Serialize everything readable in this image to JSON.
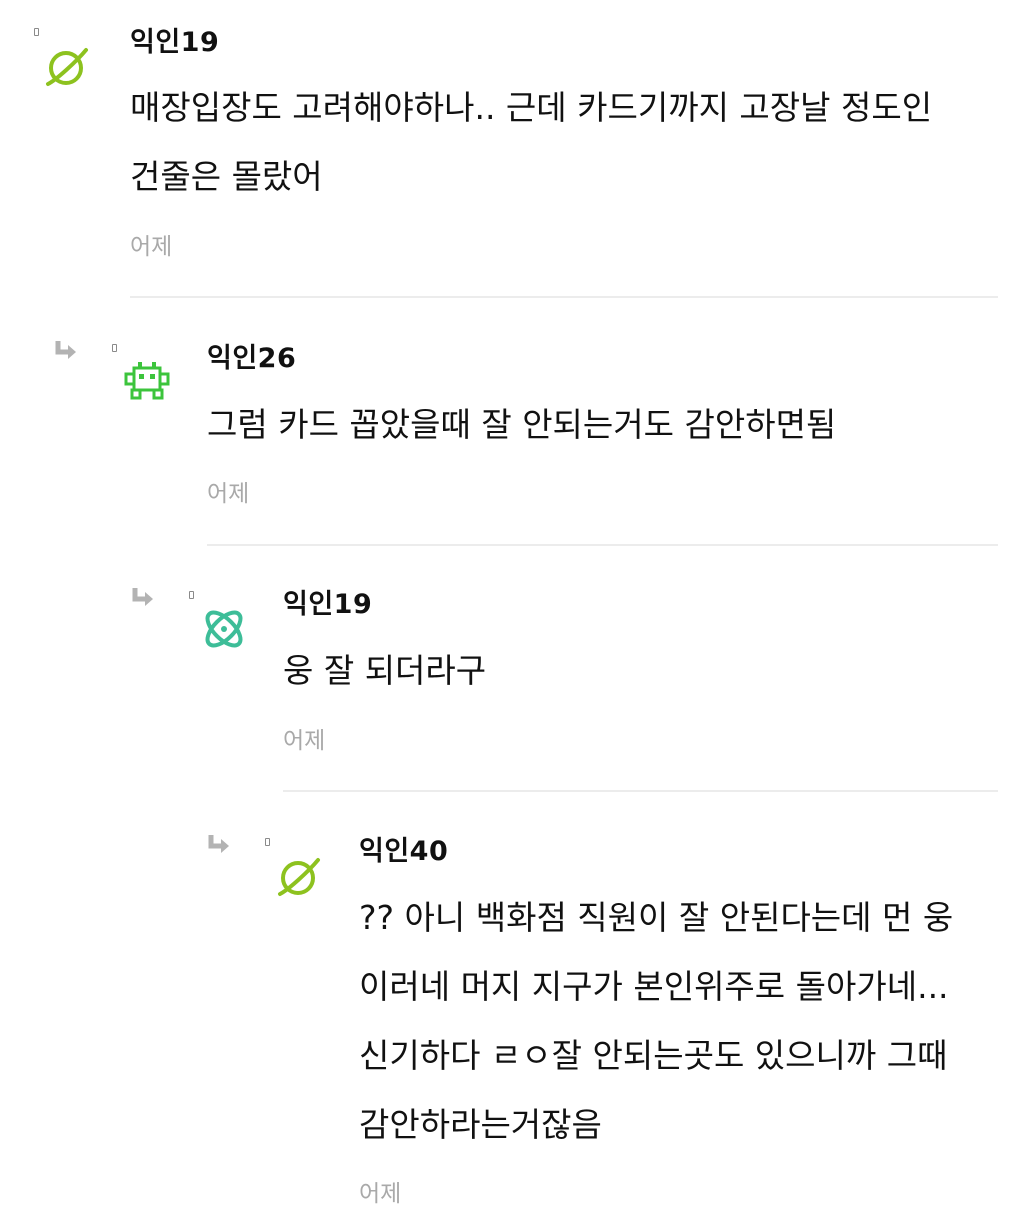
{
  "comments": [
    {
      "author": "익인19",
      "avatar_icon": "planet-icon",
      "avatar_color": "#8dc21f",
      "lines": [
        "매장입장도 고려해야하나.. 근데 카드기까지 고장날 정도인",
        "건줄은 몰랐어"
      ],
      "time": "어제"
    },
    {
      "author": "익인26",
      "avatar_icon": "space-invader-icon",
      "avatar_color": "#3cc43c",
      "lines": [
        "그럼 카드 꼽았을때 잘 안되는거도 감안하면됨"
      ],
      "time": "어제"
    },
    {
      "author": "익인19",
      "avatar_icon": "atom-icon",
      "avatar_color": "#3dbd98",
      "lines": [
        "웅 잘 되더라구"
      ],
      "time": "어제"
    },
    {
      "author": "익인40",
      "avatar_icon": "planet-icon",
      "avatar_color": "#8dc21f",
      "lines": [
        "?? 아니 백화점 직원이 잘 안된다는데 먼 웅",
        "이러네 머지 지구가 본인위주로 돌아가네...",
        "신기하다 ㄹㅇ잘 안되는곳도 있으니까 그때",
        "감안하라는거잖음"
      ],
      "time": "어제"
    }
  ],
  "colors": {
    "divider": "#ececec",
    "timestamp": "#a9a9a9",
    "reply_arrow": "#b3b3b3"
  }
}
